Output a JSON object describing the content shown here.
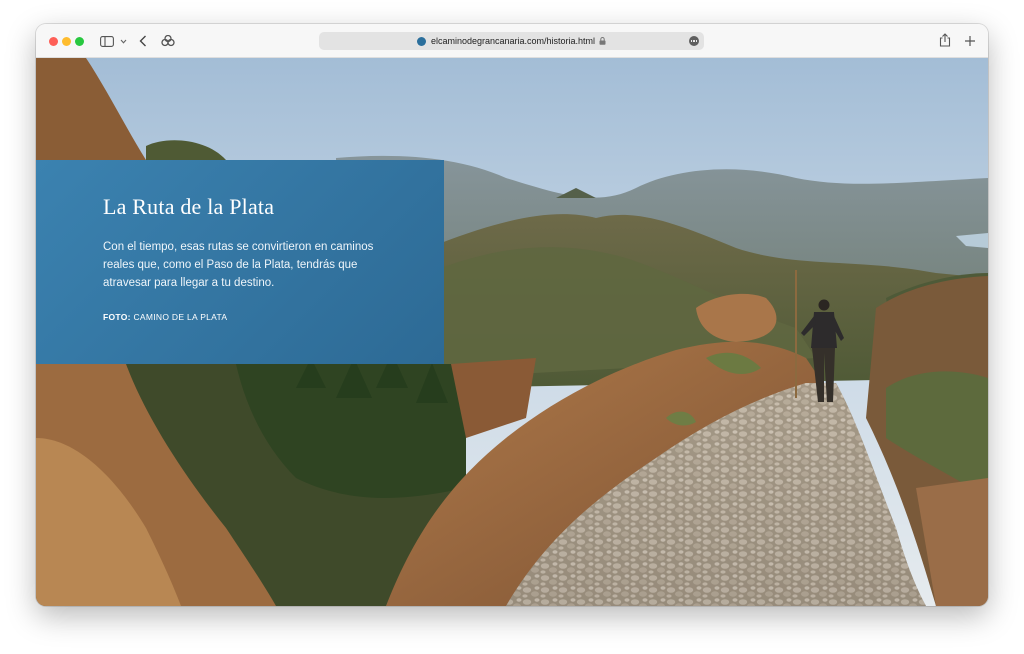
{
  "browser": {
    "url": "elcaminodegrancanaria.com/historia.html",
    "icons": [
      "sidebar-icon",
      "chevron-down-icon",
      "back-icon",
      "extension-icon",
      "lock-icon",
      "more-icon",
      "share-icon",
      "plus-icon"
    ],
    "site_icon_color": "#2b6f9c"
  },
  "hero": {
    "title": "La Ruta de la Plata",
    "body": "Con el tiempo, esas rutas se convirtieron en caminos reales que, como el Paso de la Plata, tendrás que atravesar para llegar a tu destino.",
    "credit_label": "FOTO:",
    "credit_text": "CAMINO DE LA PLATA",
    "card_color": "#2f6f9b"
  }
}
